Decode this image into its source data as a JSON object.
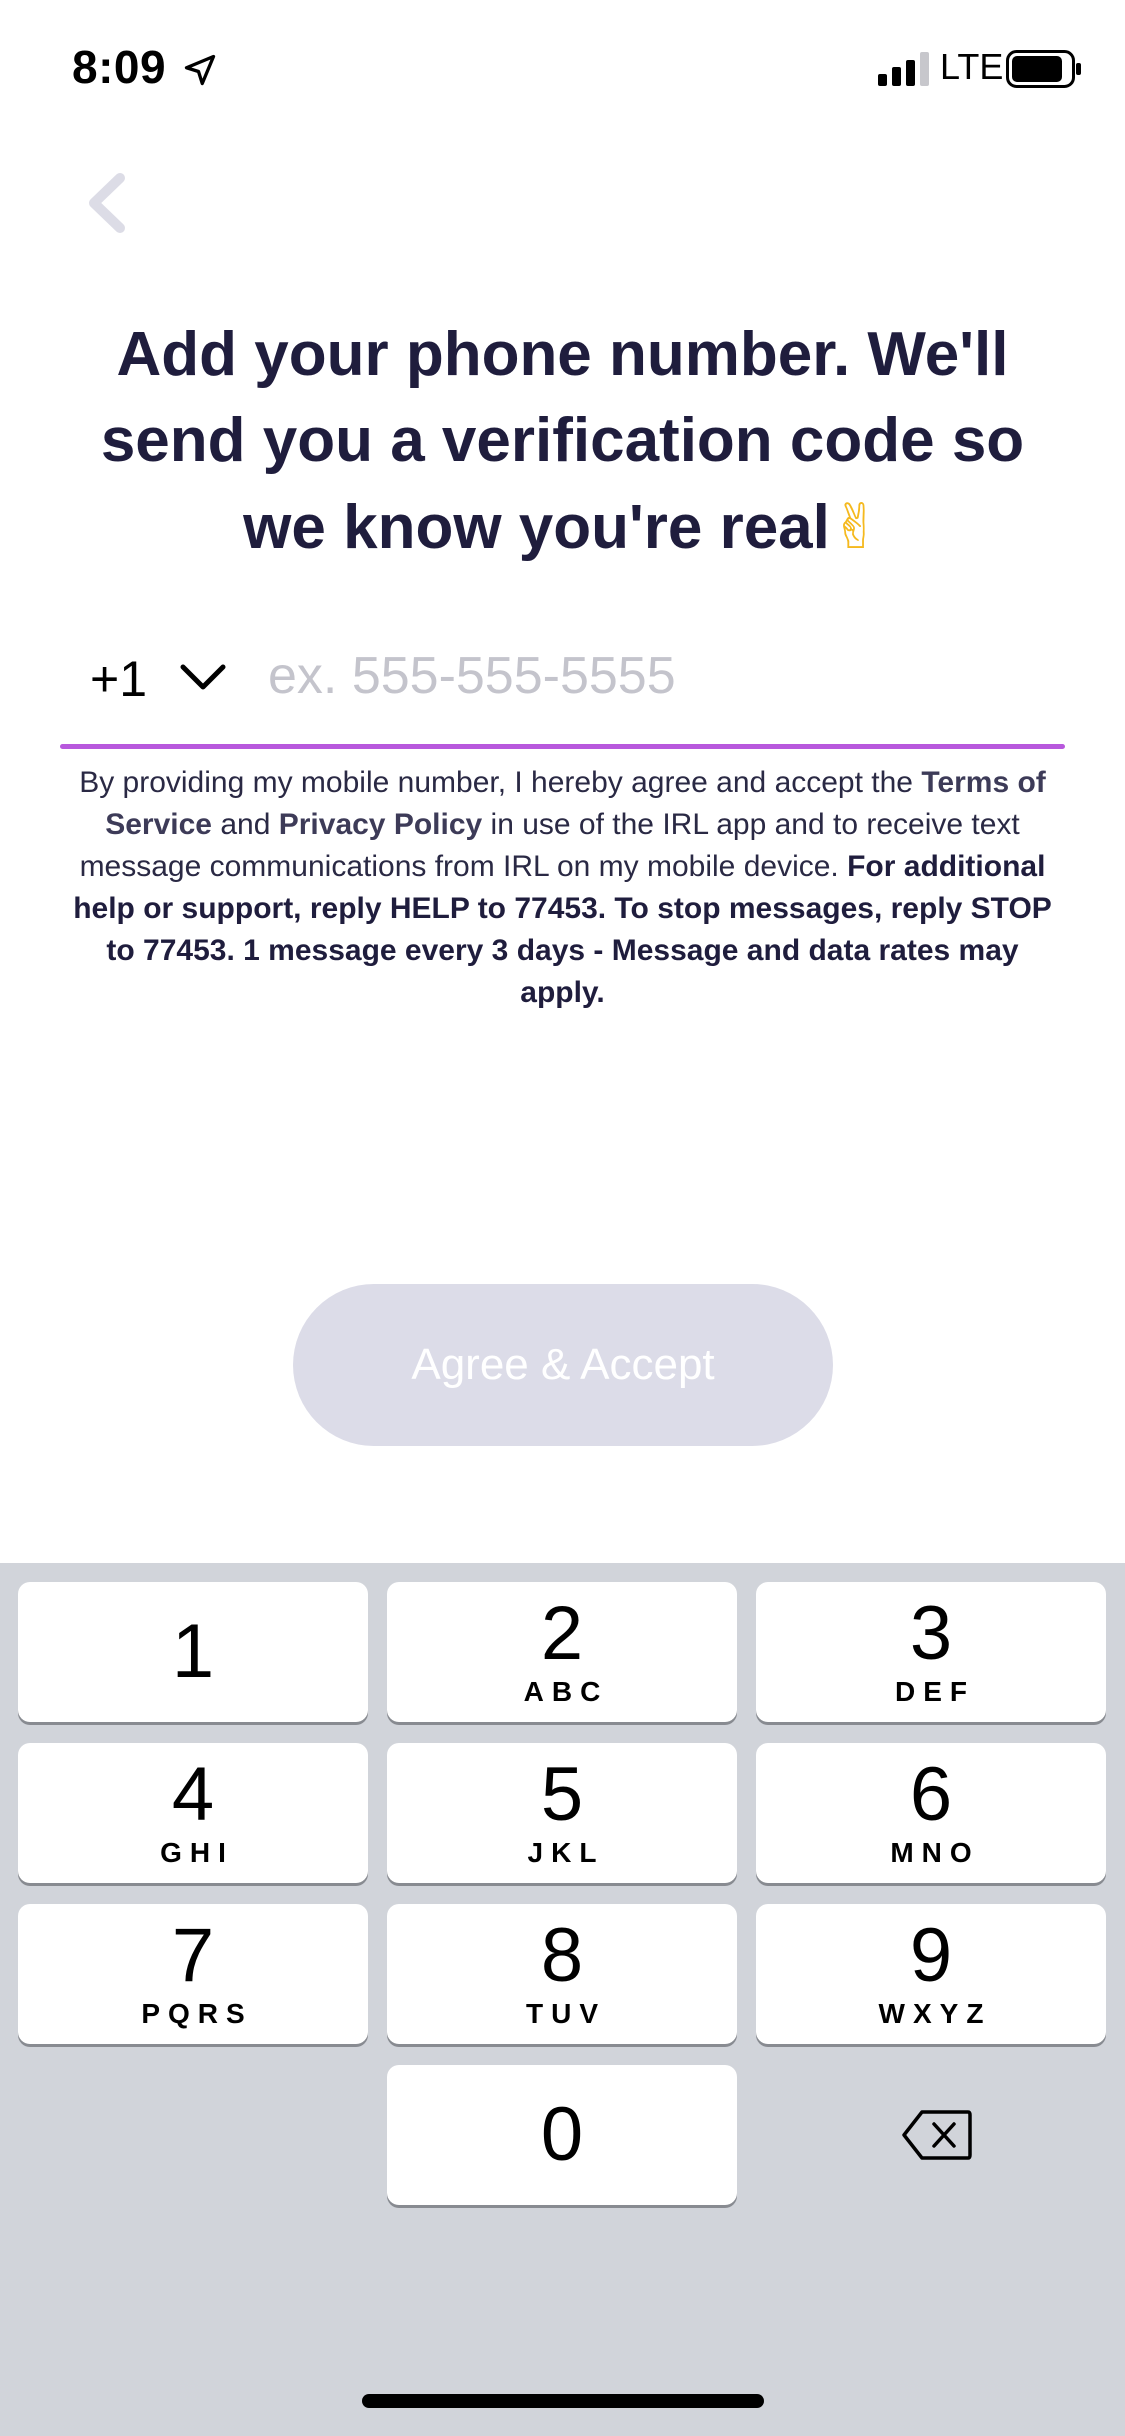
{
  "status_bar": {
    "time": "8:09",
    "network": "LTE"
  },
  "header": {
    "title": "Add your phone number. We'll send you a verification code so we know you're real",
    "title_emoji": "✌"
  },
  "phone": {
    "country_code": "+1",
    "placeholder": "ex. 555-555-5555",
    "value": ""
  },
  "legal": {
    "intro": "By providing my mobile number, I hereby agree and accept the ",
    "terms_link": "Terms of Service",
    "and": " and ",
    "privacy_link": "Privacy Policy",
    "middle": " in use of the IRL app and to receive text message communications from IRL on my mobile device. ",
    "bold_notice": "For additional help or support, reply HELP to 77453. To stop messages, reply STOP to 77453. 1 message every 3 days - Message and data rates may apply."
  },
  "cta": {
    "label": "Agree & Accept"
  },
  "keypad": {
    "keys": [
      {
        "digit": "1",
        "letters": ""
      },
      {
        "digit": "2",
        "letters": "ABC"
      },
      {
        "digit": "3",
        "letters": "DEF"
      },
      {
        "digit": "4",
        "letters": "GHI"
      },
      {
        "digit": "5",
        "letters": "JKL"
      },
      {
        "digit": "6",
        "letters": "MNO"
      },
      {
        "digit": "7",
        "letters": "PQRS"
      },
      {
        "digit": "8",
        "letters": "TUV"
      },
      {
        "digit": "9",
        "letters": "WXYZ"
      },
      {
        "digit": "0",
        "letters": ""
      }
    ]
  },
  "colors": {
    "accent_underline": "#b858dd",
    "title_text": "#1f1d3d",
    "button_disabled": "#dcdce8",
    "keypad_background": "#d1d4da"
  },
  "icons": {
    "back": "chevron-left-icon",
    "location": "location-arrow-icon",
    "signal": "cellular-signal-icon",
    "battery": "battery-icon",
    "country_dropdown": "chevron-down-icon",
    "delete": "backspace-icon"
  }
}
